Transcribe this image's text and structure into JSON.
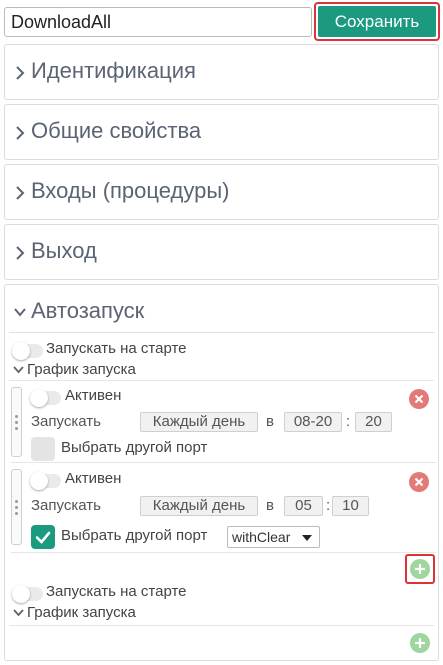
{
  "top": {
    "name_value": "DownloadAll",
    "save_label": "Сохранить"
  },
  "panels": [
    {
      "title": "Идентификация"
    },
    {
      "title": "Общие свойства"
    },
    {
      "title": "Входы (процедуры)"
    },
    {
      "title": "Выход"
    }
  ],
  "autostart": {
    "title": "Автозапуск",
    "run_on_start_label": "Запускать на старте",
    "schedule_label": "График запуска",
    "jobs": [
      {
        "active_label": "Активен",
        "run_label": "Запускать",
        "frequency": "Каждый день",
        "at_label": "в",
        "hour": "08-20",
        "colon": ":",
        "minute": "20",
        "other_port_label": "Выбрать другой порт",
        "other_port_checked": false
      },
      {
        "active_label": "Активен",
        "run_label": "Запускать",
        "frequency": "Каждый день",
        "at_label": "в",
        "hour": "05",
        "colon": ":",
        "minute": "10",
        "other_port_label": "Выбрать другой порт",
        "other_port_checked": true,
        "port_select_value": "withClear"
      }
    ],
    "second_block": {
      "run_on_start_label": "Запускать на старте",
      "schedule_label": "График запуска"
    }
  },
  "colors": {
    "accent": "#1b9a80",
    "highlight": "#d9343a",
    "delete": "#e27a78",
    "add": "#9fd59f",
    "panel_title": "#5b6473"
  }
}
